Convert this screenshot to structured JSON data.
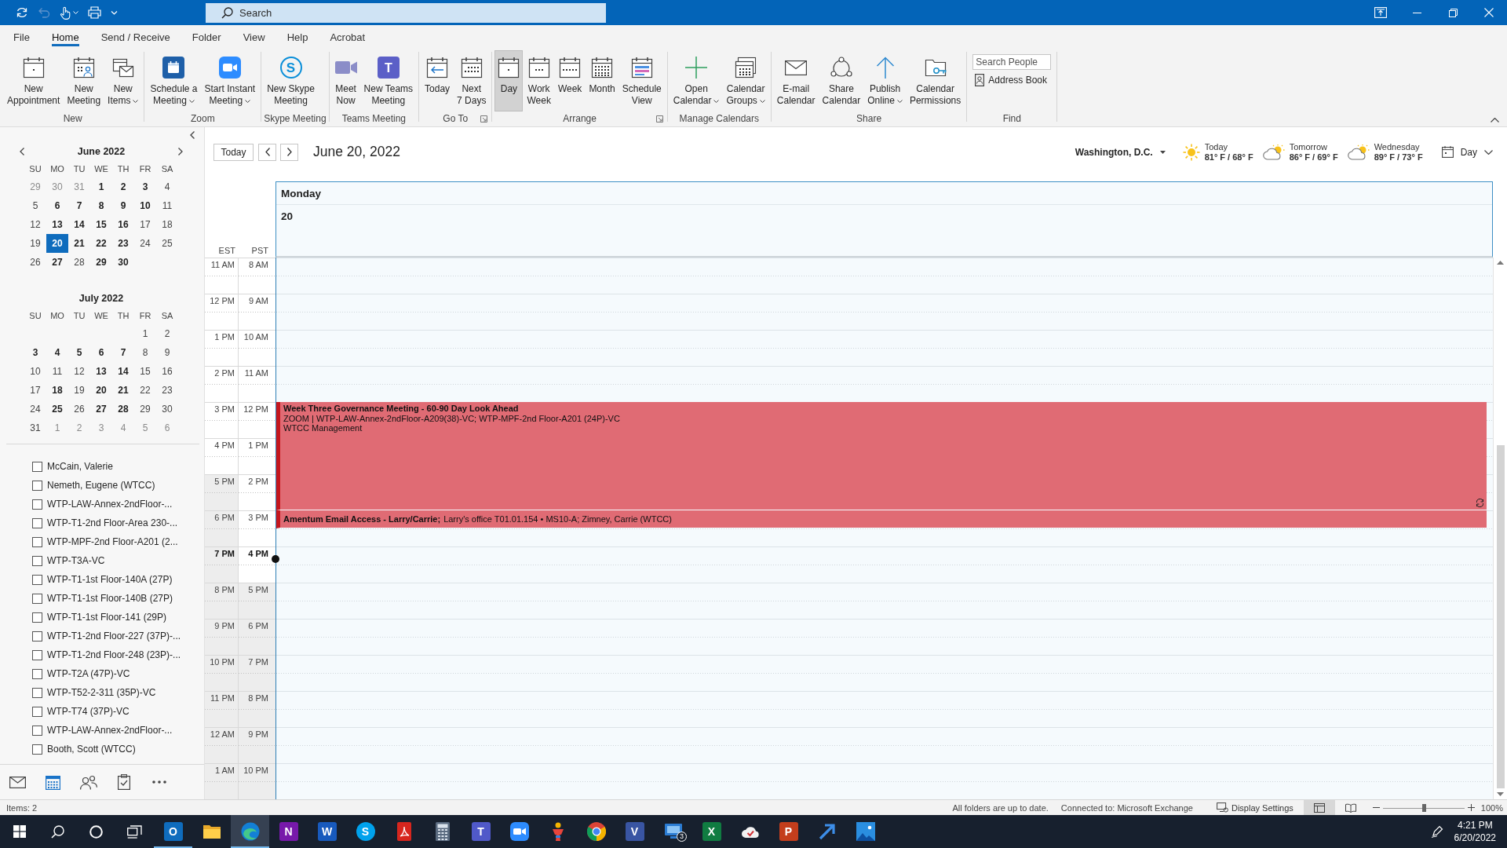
{
  "title_bar": {
    "quick_access": [
      {
        "kind": "sync",
        "disabled": false
      },
      {
        "kind": "undo",
        "disabled": true
      },
      {
        "kind": "touch",
        "disabled": false
      },
      {
        "kind": "print",
        "disabled": false
      },
      {
        "kind": "customize",
        "disabled": false
      }
    ],
    "search": {
      "placeholder": "Search"
    }
  },
  "menu_tabs": [
    {
      "label": "File",
      "selected": false
    },
    {
      "label": "Home",
      "selected": true
    },
    {
      "label": "Send / Receive",
      "selected": false
    },
    {
      "label": "Folder",
      "selected": false
    },
    {
      "label": "View",
      "selected": false
    },
    {
      "label": "Help",
      "selected": false
    },
    {
      "label": "Acrobat",
      "selected": false
    }
  ],
  "ribbon": {
    "groups": [
      {
        "label": "New",
        "launcher": false,
        "items": [
          {
            "kind": "new-appointment",
            "lines": [
              "New",
              "Appointment"
            ],
            "dropdown": false
          },
          {
            "kind": "new-meeting",
            "lines": [
              "New",
              "Meeting"
            ],
            "dropdown": false
          },
          {
            "kind": "new-items",
            "lines": [
              "New",
              "Items"
            ],
            "dropdown": true
          }
        ]
      },
      {
        "label": "Zoom",
        "launcher": false,
        "items": [
          {
            "kind": "schedule-meeting",
            "lines": [
              "Schedule a",
              "Meeting"
            ],
            "dropdown": true
          },
          {
            "kind": "instant-meeting",
            "lines": [
              "Start Instant",
              "Meeting"
            ],
            "dropdown": true
          }
        ]
      },
      {
        "label": "Skype Meeting",
        "launcher": false,
        "items": [
          {
            "kind": "skype-meeting",
            "glyph": "S",
            "lines": [
              "New Skype",
              "Meeting"
            ],
            "dropdown": false
          }
        ]
      },
      {
        "label": "Teams Meeting",
        "launcher": false,
        "items": [
          {
            "kind": "meet-now",
            "lines": [
              "Meet",
              "Now"
            ],
            "dropdown": false
          },
          {
            "kind": "teams-meeting",
            "glyph": "T",
            "lines": [
              "New Teams",
              "Meeting"
            ],
            "dropdown": false
          }
        ]
      },
      {
        "label": "Go To",
        "launcher": true,
        "items": [
          {
            "kind": "today",
            "lines": [
              "Today"
            ],
            "dropdown": false
          },
          {
            "kind": "next-7-days",
            "lines": [
              "Next",
              "7 Days"
            ],
            "dropdown": false
          }
        ]
      },
      {
        "label": "Arrange",
        "launcher": true,
        "items": [
          {
            "kind": "day-view",
            "lines": [
              "Day"
            ],
            "dropdown": false,
            "selected": true
          },
          {
            "kind": "work-week-view",
            "lines": [
              "Work",
              "Week"
            ],
            "dropdown": false,
            "selected": false
          },
          {
            "kind": "week-view",
            "lines": [
              "Week"
            ],
            "dropdown": false,
            "selected": false
          },
          {
            "kind": "month-view",
            "lines": [
              "Month"
            ],
            "dropdown": false,
            "selected": false
          },
          {
            "kind": "schedule-view",
            "lines": [
              "Schedule",
              "View"
            ],
            "dropdown": false,
            "selected": false
          }
        ]
      },
      {
        "label": "Manage Calendars",
        "launcher": false,
        "items": [
          {
            "kind": "open-calendar",
            "lines": [
              "Open",
              "Calendar"
            ],
            "dropdown": true
          },
          {
            "kind": "calendar-groups",
            "lines": [
              "Calendar",
              "Groups"
            ],
            "dropdown": true
          }
        ]
      },
      {
        "label": "Share",
        "launcher": false,
        "items": [
          {
            "kind": "email-calendar",
            "lines": [
              "E-mail",
              "Calendar"
            ],
            "dropdown": false
          },
          {
            "kind": "share-calendar",
            "lines": [
              "Share",
              "Calendar"
            ],
            "dropdown": false
          },
          {
            "kind": "publish-online",
            "lines": [
              "Publish",
              "Online"
            ],
            "dropdown": true
          },
          {
            "kind": "calendar-permissions",
            "lines": [
              "Calendar",
              "Permissions"
            ],
            "dropdown": false
          }
        ]
      },
      {
        "label": "Find",
        "launcher": false,
        "items": [
          {
            "kind": "search-people",
            "placeholder": "Search People"
          },
          {
            "kind": "address-book",
            "label": "Address Book"
          }
        ]
      }
    ]
  },
  "date_picker": {
    "months": [
      {
        "title": "June 2022",
        "weekdays": [
          "SU",
          "MO",
          "TU",
          "WE",
          "TH",
          "FR",
          "SA"
        ],
        "weeks": [
          [
            {
              "day": "29",
              "other_month": true,
              "has_items": false,
              "selected": false
            },
            {
              "day": "30",
              "other_month": true,
              "has_items": false,
              "selected": false
            },
            {
              "day": "31",
              "other_month": true,
              "has_items": false,
              "selected": false
            },
            {
              "day": "1",
              "other_month": false,
              "has_items": true,
              "selected": false
            },
            {
              "day": "2",
              "other_month": false,
              "has_items": true,
              "selected": false
            },
            {
              "day": "3",
              "other_month": false,
              "has_items": true,
              "selected": false
            },
            {
              "day": "4",
              "other_month": false,
              "has_items": false,
              "selected": false
            }
          ],
          [
            {
              "day": "5",
              "other_month": false,
              "has_items": false,
              "selected": false
            },
            {
              "day": "6",
              "other_month": false,
              "has_items": true,
              "selected": false
            },
            {
              "day": "7",
              "other_month": false,
              "has_items": true,
              "selected": false
            },
            {
              "day": "8",
              "other_month": false,
              "has_items": true,
              "selected": false
            },
            {
              "day": "9",
              "other_month": false,
              "has_items": true,
              "selected": false
            },
            {
              "day": "10",
              "other_month": false,
              "has_items": true,
              "selected": false
            },
            {
              "day": "11",
              "other_month": false,
              "has_items": false,
              "selected": false
            }
          ],
          [
            {
              "day": "12",
              "other_month": false,
              "has_items": false,
              "selected": false
            },
            {
              "day": "13",
              "other_month": false,
              "has_items": true,
              "selected": false
            },
            {
              "day": "14",
              "other_month": false,
              "has_items": true,
              "selected": false
            },
            {
              "day": "15",
              "other_month": false,
              "has_items": true,
              "selected": false
            },
            {
              "day": "16",
              "other_month": false,
              "has_items": true,
              "selected": false
            },
            {
              "day": "17",
              "other_month": false,
              "has_items": false,
              "selected": false
            },
            {
              "day": "18",
              "other_month": false,
              "has_items": false,
              "selected": false
            }
          ],
          [
            {
              "day": "19",
              "other_month": false,
              "has_items": false,
              "selected": false
            },
            {
              "day": "20",
              "other_month": false,
              "has_items": true,
              "selected": true
            },
            {
              "day": "21",
              "other_month": false,
              "has_items": true,
              "selected": false
            },
            {
              "day": "22",
              "other_month": false,
              "has_items": true,
              "selected": false
            },
            {
              "day": "23",
              "other_month": false,
              "has_items": true,
              "selected": false
            },
            {
              "day": "24",
              "other_month": false,
              "has_items": false,
              "selected": false
            },
            {
              "day": "25",
              "other_month": false,
              "has_items": false,
              "selected": false
            }
          ],
          [
            {
              "day": "26",
              "other_month": false,
              "has_items": false,
              "selected": false
            },
            {
              "day": "27",
              "other_month": false,
              "has_items": true,
              "selected": false
            },
            {
              "day": "28",
              "other_month": false,
              "has_items": false,
              "selected": false
            },
            {
              "day": "29",
              "other_month": false,
              "has_items": true,
              "selected": false
            },
            {
              "day": "30",
              "other_month": false,
              "has_items": true,
              "selected": false
            }
          ]
        ]
      },
      {
        "title": "July 2022",
        "weekdays": [
          "SU",
          "MO",
          "TU",
          "WE",
          "TH",
          "FR",
          "SA"
        ],
        "weeks": [
          [
            {
              "day": "1",
              "other_month": false,
              "has_items": false,
              "selected": false
            },
            {
              "day": "2",
              "other_month": false,
              "has_items": false,
              "selected": false
            }
          ],
          [
            {
              "day": "3",
              "other_month": false,
              "has_items": true,
              "selected": false
            },
            {
              "day": "4",
              "other_month": false,
              "has_items": true,
              "selected": false
            },
            {
              "day": "5",
              "other_month": false,
              "has_items": true,
              "selected": false
            },
            {
              "day": "6",
              "other_month": false,
              "has_items": true,
              "selected": false
            },
            {
              "day": "7",
              "other_month": false,
              "has_items": true,
              "selected": false
            },
            {
              "day": "8",
              "other_month": false,
              "has_items": false,
              "selected": false
            },
            {
              "day": "9",
              "other_month": false,
              "has_items": false,
              "selected": false
            }
          ],
          [
            {
              "day": "10",
              "other_month": false,
              "has_items": false,
              "selected": false
            },
            {
              "day": "11",
              "other_month": false,
              "has_items": false,
              "selected": false
            },
            {
              "day": "12",
              "other_month": false,
              "has_items": false,
              "selected": false
            },
            {
              "day": "13",
              "other_month": false,
              "has_items": true,
              "selected": false
            },
            {
              "day": "14",
              "other_month": false,
              "has_items": true,
              "selected": false
            },
            {
              "day": "15",
              "other_month": false,
              "has_items": false,
              "selected": false
            },
            {
              "day": "16",
              "other_month": false,
              "has_items": false,
              "selected": false
            }
          ],
          [
            {
              "day": "17",
              "other_month": false,
              "has_items": false,
              "selected": false
            },
            {
              "day": "18",
              "other_month": false,
              "has_items": true,
              "selected": false
            },
            {
              "day": "19",
              "other_month": false,
              "has_items": false,
              "selected": false
            },
            {
              "day": "20",
              "other_month": false,
              "has_items": true,
              "selected": false
            },
            {
              "day": "21",
              "other_month": false,
              "has_items": true,
              "selected": false
            },
            {
              "day": "22",
              "other_month": false,
              "has_items": false,
              "selected": false
            },
            {
              "day": "23",
              "other_month": false,
              "has_items": false,
              "selected": false
            }
          ],
          [
            {
              "day": "24",
              "other_month": false,
              "has_items": false,
              "selected": false
            },
            {
              "day": "25",
              "other_month": false,
              "has_items": true,
              "selected": false
            },
            {
              "day": "26",
              "other_month": false,
              "has_items": false,
              "selected": false
            },
            {
              "day": "27",
              "other_month": false,
              "has_items": true,
              "selected": false
            },
            {
              "day": "28",
              "other_month": false,
              "has_items": true,
              "selected": false
            },
            {
              "day": "29",
              "other_month": false,
              "has_items": false,
              "selected": false
            },
            {
              "day": "30",
              "other_month": false,
              "has_items": false,
              "selected": false
            }
          ],
          [
            {
              "day": "31",
              "other_month": false,
              "has_items": false,
              "selected": false
            },
            {
              "day": "1",
              "other_month": true,
              "has_items": false,
              "selected": false
            },
            {
              "day": "2",
              "other_month": true,
              "has_items": false,
              "selected": false
            },
            {
              "day": "3",
              "other_month": true,
              "has_items": false,
              "selected": false
            },
            {
              "day": "4",
              "other_month": true,
              "has_items": false,
              "selected": false
            },
            {
              "day": "5",
              "other_month": true,
              "has_items": false,
              "selected": false
            },
            {
              "day": "6",
              "other_month": true,
              "has_items": false,
              "selected": false
            }
          ]
        ]
      }
    ]
  },
  "calendars": [
    {
      "label": "McCain, Valerie",
      "checked": false
    },
    {
      "label": "Nemeth, Eugene (WTCC)",
      "checked": false
    },
    {
      "label": "WTP-LAW-Annex-2ndFloor-...",
      "checked": false
    },
    {
      "label": "WTP-T1-2nd Floor-Area 230-...",
      "checked": false
    },
    {
      "label": "WTP-MPF-2nd Floor-A201 (2...",
      "checked": false
    },
    {
      "label": "WTP-T3A-VC",
      "checked": false
    },
    {
      "label": "WTP-T1-1st Floor-140A (27P)",
      "checked": false
    },
    {
      "label": "WTP-T1-1st Floor-140B (27P)",
      "checked": false
    },
    {
      "label": "WTP-T1-1st Floor-141 (29P)",
      "checked": false
    },
    {
      "label": "WTP-T1-2nd Floor-227 (37P)-...",
      "checked": false
    },
    {
      "label": "WTP-T1-2nd Floor-248 (23P)-...",
      "checked": false
    },
    {
      "label": "WTP-T2A (47P)-VC",
      "checked": false
    },
    {
      "label": "WTP-T52-2-311 (35P)-VC",
      "checked": false
    },
    {
      "label": "WTP-T74 (37P)-VC",
      "checked": false
    },
    {
      "label": "WTP-LAW-Annex-2ndFloor-...",
      "checked": false
    },
    {
      "label": "Booth, Scott (WTCC)",
      "checked": false
    }
  ],
  "nav_bar": [
    {
      "kind": "mail",
      "selected": false
    },
    {
      "kind": "calendar",
      "selected": true
    },
    {
      "kind": "people",
      "selected": false
    },
    {
      "kind": "tasks",
      "selected": false
    },
    {
      "kind": "more",
      "selected": false
    }
  ],
  "calendar_header": {
    "today_button": "Today",
    "date_title": "June 20, 2022",
    "location": "Washington, D.C.",
    "forecast": [
      {
        "kind": "sunny",
        "day": "Today",
        "temps": "81° F / 68° F"
      },
      {
        "kind": "partly-cloudy",
        "day": "Tomorrow",
        "temps": "86° F / 69° F"
      },
      {
        "kind": "partly-cloudy",
        "day": "Wednesday",
        "temps": "89° F / 73° F"
      }
    ],
    "view_button": "Day"
  },
  "day_view": {
    "day_name": "Monday",
    "day_number": "20",
    "time_zones": [
      "EST",
      "PST"
    ],
    "slots": [
      {
        "est": "11 AM",
        "pst": "8 AM",
        "est_working": true,
        "pst_working": true,
        "current": false
      },
      {
        "est": "12 PM",
        "pst": "9 AM",
        "est_working": true,
        "pst_working": true,
        "current": false
      },
      {
        "est": "1 PM",
        "pst": "10 AM",
        "est_working": true,
        "pst_working": true,
        "current": false
      },
      {
        "est": "2 PM",
        "pst": "11 AM",
        "est_working": true,
        "pst_working": true,
        "current": false
      },
      {
        "est": "3 PM",
        "pst": "12 PM",
        "est_working": true,
        "pst_working": true,
        "current": false,
        "events": [
          {
            "kind": "stacked",
            "title": "Week Three Governance Meeting - 60-90 Day Look Ahead",
            "details": [
              "ZOOM | WTP-LAW-Annex-2ndFloor-A209(38)-VC; WTP-MPF-2nd Floor-A201 (24P)-VC",
              "WTCC Management"
            ],
            "half_hour": false,
            "recurring": true
          }
        ]
      },
      {
        "est": "4 PM",
        "pst": "1 PM",
        "est_working": true,
        "pst_working": true,
        "current": false,
        "event_continues": true
      },
      {
        "est": "5 PM",
        "pst": "2 PM",
        "est_working": false,
        "pst_working": true,
        "current": false,
        "event_continues": true
      },
      {
        "est": "6 PM",
        "pst": "3 PM",
        "est_working": false,
        "pst_working": true,
        "current": false,
        "events": [
          {
            "kind": "inline",
            "title": "Amentum Email Access - Larry/Carrie;",
            "details": [
              "Larry's office T01.01.154 • MS10-A; Zimney, Carrie (WTCC)"
            ],
            "half_hour": true,
            "recurring": false
          }
        ]
      },
      {
        "est": "7 PM",
        "pst": "4 PM",
        "est_working": false,
        "pst_working": true,
        "current": true
      },
      {
        "est": "8 PM",
        "pst": "5 PM",
        "est_working": false,
        "pst_working": false,
        "current": false
      },
      {
        "est": "9 PM",
        "pst": "6 PM",
        "est_working": false,
        "pst_working": false,
        "current": false
      },
      {
        "est": "10 PM",
        "pst": "7 PM",
        "est_working": false,
        "pst_working": false,
        "current": false
      },
      {
        "est": "11 PM",
        "pst": "8 PM",
        "est_working": false,
        "pst_working": false,
        "current": false
      },
      {
        "est": "12 AM",
        "pst": "9 PM",
        "est_working": false,
        "pst_working": false,
        "current": false
      },
      {
        "est": "1 AM",
        "pst": "10 PM",
        "est_working": false,
        "pst_working": false,
        "current": false
      }
    ]
  },
  "status_bar": {
    "items": "Items: 2",
    "sync_status": "All folders are up to date.",
    "connection": "Connected to: Microsoft Exchange",
    "display_settings": "Display Settings",
    "views": [
      {
        "kind": "normal",
        "selected": true
      },
      {
        "kind": "reading",
        "selected": false
      }
    ],
    "zoom": {
      "level": 0.5,
      "reading": "100%"
    }
  },
  "taskbar": {
    "apps": [
      {
        "kind": "mail",
        "glyph": "O",
        "open": true,
        "selected": false
      },
      {
        "kind": "folder",
        "open": false,
        "selected": false
      },
      {
        "kind": "browser",
        "open": true,
        "selected": true
      },
      {
        "kind": "notebook",
        "glyph": "N",
        "open": false,
        "selected": false
      },
      {
        "kind": "document",
        "glyph": "W",
        "open": false,
        "selected": false
      },
      {
        "kind": "chat",
        "glyph": "S",
        "open": false,
        "selected": false
      },
      {
        "kind": "pdf",
        "open": false,
        "selected": false
      },
      {
        "kind": "calculator",
        "open": false,
        "selected": false
      },
      {
        "kind": "team",
        "glyph": "T",
        "open": false,
        "selected": false
      },
      {
        "kind": "video",
        "open": false,
        "selected": false
      },
      {
        "kind": "figure",
        "open": false,
        "selected": false
      },
      {
        "kind": "globe",
        "open": false,
        "selected": false
      },
      {
        "kind": "diagram",
        "glyph": "V",
        "open": false,
        "selected": false
      },
      {
        "kind": "screen",
        "badge": "3",
        "open": false,
        "selected": false
      },
      {
        "kind": "sheet",
        "glyph": "X",
        "open": false,
        "selected": false
      },
      {
        "kind": "cloud",
        "open": false,
        "selected": false
      },
      {
        "kind": "slides",
        "glyph": "P",
        "open": false,
        "selected": false
      },
      {
        "kind": "arrow",
        "open": false,
        "selected": false
      },
      {
        "kind": "photos",
        "open": false,
        "selected": false
      }
    ],
    "clock": {
      "time": "4:21 PM",
      "date": "6/20/2022"
    }
  }
}
